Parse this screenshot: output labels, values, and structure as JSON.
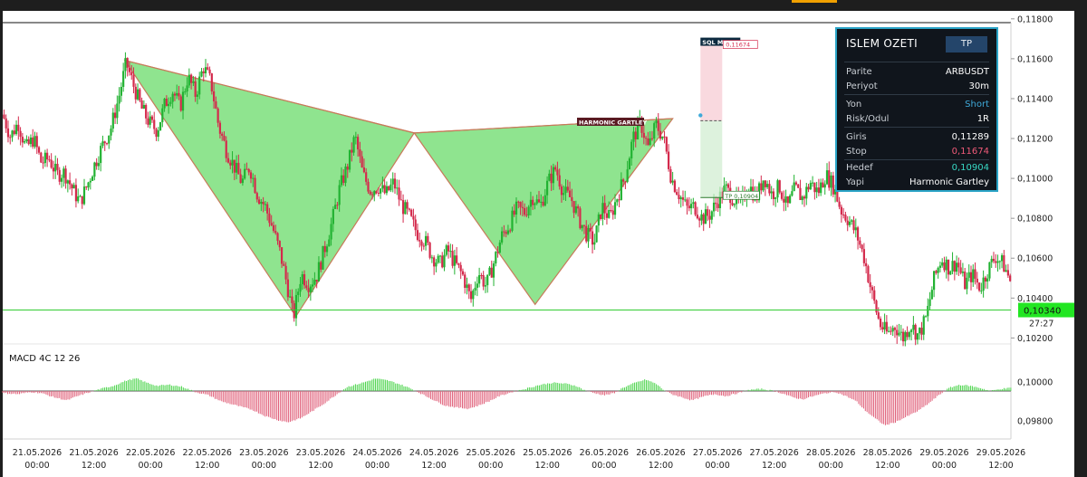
{
  "chart_data": {
    "type": "candlestick",
    "symbol": "ARBUSDT",
    "y_ticks": [
      "0,11800",
      "0,11600",
      "0,11400",
      "0,11200",
      "0,11000",
      "0,10800",
      "0,10600",
      "0,10400",
      "0,10200"
    ],
    "ylim": [
      0.1017,
      0.1184
    ],
    "x_ticks": [
      {
        "date": "21.05.2026",
        "time": "00:00"
      },
      {
        "date": "21.05.2026",
        "time": "12:00"
      },
      {
        "date": "22.05.2026",
        "time": "00:00"
      },
      {
        "date": "22.05.2026",
        "time": "12:00"
      },
      {
        "date": "23.05.2026",
        "time": "00:00"
      },
      {
        "date": "23.05.2026",
        "time": "12:00"
      },
      {
        "date": "24.05.2026",
        "time": "00:00"
      },
      {
        "date": "24.05.2026",
        "time": "12:00"
      },
      {
        "date": "25.05.2026",
        "time": "00:00"
      },
      {
        "date": "25.05.2026",
        "time": "12:00"
      },
      {
        "date": "26.05.2026",
        "time": "00:00"
      },
      {
        "date": "26.05.2026",
        "time": "12:00"
      },
      {
        "date": "27.05.2026",
        "time": "00:00"
      },
      {
        "date": "27.05.2026",
        "time": "12:00"
      },
      {
        "date": "28.05.2026",
        "time": "00:00"
      },
      {
        "date": "28.05.2026",
        "time": "12:00"
      },
      {
        "date": "29.05.2026",
        "time": "00:00"
      },
      {
        "date": "29.05.2026",
        "time": "12:00"
      }
    ],
    "price_path": [
      [
        0,
        0.1132
      ],
      [
        6,
        0.1121
      ],
      [
        12,
        0.1128
      ],
      [
        18,
        0.1115
      ],
      [
        24,
        0.112
      ],
      [
        30,
        0.1108
      ],
      [
        36,
        0.111
      ],
      [
        42,
        0.1102
      ],
      [
        48,
        0.1103
      ],
      [
        54,
        0.1095
      ],
      [
        60,
        0.1088
      ],
      [
        66,
        0.1097
      ],
      [
        72,
        0.1108
      ],
      [
        78,
        0.1117
      ],
      [
        84,
        0.1125
      ],
      [
        90,
        0.114
      ],
      [
        96,
        0.1158
      ],
      [
        102,
        0.1146
      ],
      [
        108,
        0.1135
      ],
      [
        114,
        0.1128
      ],
      [
        120,
        0.1124
      ],
      [
        126,
        0.1137
      ],
      [
        132,
        0.1144
      ],
      [
        138,
        0.1136
      ],
      [
        144,
        0.1151
      ],
      [
        150,
        0.1142
      ],
      [
        156,
        0.1156
      ],
      [
        162,
        0.1148
      ],
      [
        168,
        0.1126
      ],
      [
        174,
        0.1114
      ],
      [
        180,
        0.1106
      ],
      [
        186,
        0.1098
      ],
      [
        192,
        0.1106
      ],
      [
        198,
        0.1092
      ],
      [
        204,
        0.1086
      ],
      [
        210,
        0.1075
      ],
      [
        216,
        0.1062
      ],
      [
        222,
        0.1044
      ],
      [
        226,
        0.103
      ],
      [
        232,
        0.1052
      ],
      [
        238,
        0.1047
      ],
      [
        244,
        0.1051
      ],
      [
        250,
        0.1064
      ],
      [
        256,
        0.1078
      ],
      [
        262,
        0.1095
      ],
      [
        268,
        0.1106
      ],
      [
        274,
        0.1121
      ],
      [
        280,
        0.1102
      ],
      [
        286,
        0.1094
      ],
      [
        292,
        0.1096
      ],
      [
        298,
        0.1092
      ],
      [
        304,
        0.1098
      ],
      [
        310,
        0.1087
      ],
      [
        316,
        0.1081
      ],
      [
        322,
        0.1073
      ],
      [
        328,
        0.1069
      ],
      [
        334,
        0.1061
      ],
      [
        340,
        0.1057
      ],
      [
        346,
        0.1064
      ],
      [
        352,
        0.1057
      ],
      [
        358,
        0.1051
      ],
      [
        364,
        0.1039
      ],
      [
        370,
        0.1053
      ],
      [
        376,
        0.1046
      ],
      [
        382,
        0.1058
      ],
      [
        388,
        0.1071
      ],
      [
        394,
        0.1077
      ],
      [
        400,
        0.1085
      ],
      [
        406,
        0.1083
      ],
      [
        412,
        0.1091
      ],
      [
        418,
        0.1086
      ],
      [
        424,
        0.1098
      ],
      [
        430,
        0.1105
      ],
      [
        436,
        0.1093
      ],
      [
        442,
        0.109
      ],
      [
        448,
        0.108
      ],
      [
        454,
        0.1072
      ],
      [
        460,
        0.1068
      ],
      [
        466,
        0.1086
      ],
      [
        472,
        0.108
      ],
      [
        478,
        0.1091
      ],
      [
        484,
        0.1101
      ],
      [
        490,
        0.112
      ],
      [
        496,
        0.1128
      ],
      [
        502,
        0.1115
      ],
      [
        508,
        0.1127
      ],
      [
        514,
        0.112
      ],
      [
        520,
        0.11
      ],
      [
        526,
        0.1092
      ],
      [
        532,
        0.1085
      ],
      [
        538,
        0.1086
      ],
      [
        544,
        0.108
      ],
      [
        550,
        0.1082
      ],
      [
        556,
        0.1089
      ],
      [
        562,
        0.1095
      ],
      [
        568,
        0.109
      ],
      [
        574,
        0.1087
      ],
      [
        580,
        0.1097
      ],
      [
        586,
        0.109
      ],
      [
        592,
        0.1101
      ],
      [
        598,
        0.1092
      ],
      [
        604,
        0.1096
      ],
      [
        610,
        0.1085
      ],
      [
        616,
        0.1095
      ],
      [
        622,
        0.109
      ],
      [
        628,
        0.1098
      ],
      [
        634,
        0.1093
      ],
      [
        640,
        0.1102
      ],
      [
        646,
        0.1096
      ],
      [
        652,
        0.1084
      ],
      [
        658,
        0.1079
      ],
      [
        664,
        0.1072
      ],
      [
        670,
        0.106
      ],
      [
        676,
        0.1042
      ],
      [
        682,
        0.1027
      ],
      [
        688,
        0.1022
      ],
      [
        694,
        0.1026
      ],
      [
        700,
        0.102
      ],
      [
        706,
        0.1027
      ],
      [
        712,
        0.1021
      ],
      [
        718,
        0.103
      ],
      [
        724,
        0.1049
      ],
      [
        730,
        0.106
      ],
      [
        736,
        0.1055
      ],
      [
        742,
        0.1058
      ],
      [
        748,
        0.1047
      ],
      [
        754,
        0.1052
      ],
      [
        760,
        0.1045
      ],
      [
        766,
        0.1054
      ],
      [
        772,
        0.1061
      ],
      [
        778,
        0.1057
      ],
      [
        784,
        0.1048
      ]
    ],
    "harmonic_points": {
      "X": [
        95,
        0.11592
      ],
      "A": [
        228,
        0.10308
      ],
      "B": [
        320,
        0.11228
      ],
      "C": [
        414,
        0.10368
      ],
      "D": [
        521,
        0.113
      ]
    },
    "pattern_label": "HARMONIC GARTLEY",
    "sql_label": "SQL Memory",
    "stop_label": "0,11674",
    "stop_value": 0.11674,
    "entry_value": 0.11289,
    "tp_label": "TP 0,10904",
    "tp_value": 0.10904,
    "current_price": 0.1034,
    "current_price_label": "0,10340",
    "countdown": "27:27",
    "macd": {
      "title": "MACD 4C 12 26",
      "y_ticks": [
        "0,10000",
        "0,09800"
      ],
      "path": [
        [
          0,
          -2
        ],
        [
          12,
          -3
        ],
        [
          22,
          -1
        ],
        [
          30,
          -2
        ],
        [
          40,
          -6
        ],
        [
          50,
          -9
        ],
        [
          58,
          -5
        ],
        [
          68,
          -1
        ],
        [
          76,
          2
        ],
        [
          86,
          5
        ],
        [
          96,
          10
        ],
        [
          104,
          12
        ],
        [
          112,
          8
        ],
        [
          120,
          5
        ],
        [
          130,
          6
        ],
        [
          140,
          4
        ],
        [
          150,
          -1
        ],
        [
          160,
          -4
        ],
        [
          170,
          -10
        ],
        [
          182,
          -14
        ],
        [
          194,
          -18
        ],
        [
          204,
          -24
        ],
        [
          214,
          -28
        ],
        [
          222,
          -30
        ],
        [
          232,
          -26
        ],
        [
          240,
          -20
        ],
        [
          250,
          -12
        ],
        [
          260,
          -3
        ],
        [
          268,
          4
        ],
        [
          280,
          8
        ],
        [
          290,
          12
        ],
        [
          300,
          10
        ],
        [
          310,
          6
        ],
        [
          318,
          2
        ],
        [
          326,
          -3
        ],
        [
          334,
          -8
        ],
        [
          344,
          -14
        ],
        [
          354,
          -16
        ],
        [
          362,
          -17
        ],
        [
          370,
          -14
        ],
        [
          378,
          -10
        ],
        [
          386,
          -5
        ],
        [
          396,
          -1
        ],
        [
          406,
          2
        ],
        [
          418,
          6
        ],
        [
          428,
          8
        ],
        [
          438,
          7
        ],
        [
          446,
          5
        ],
        [
          452,
          1
        ],
        [
          460,
          -2
        ],
        [
          468,
          -4
        ],
        [
          476,
          -2
        ],
        [
          482,
          3
        ],
        [
          492,
          8
        ],
        [
          500,
          11
        ],
        [
          508,
          7
        ],
        [
          514,
          1
        ],
        [
          520,
          -3
        ],
        [
          528,
          -6
        ],
        [
          536,
          -9
        ],
        [
          546,
          -5
        ],
        [
          554,
          -3
        ],
        [
          562,
          -5
        ],
        [
          572,
          -2
        ],
        [
          580,
          1
        ],
        [
          590,
          2
        ],
        [
          600,
          0
        ],
        [
          608,
          -3
        ],
        [
          614,
          -6
        ],
        [
          622,
          -8
        ],
        [
          630,
          -5
        ],
        [
          640,
          -2
        ],
        [
          648,
          -1
        ],
        [
          656,
          -5
        ],
        [
          664,
          -10
        ],
        [
          670,
          -18
        ],
        [
          678,
          -26
        ],
        [
          686,
          -33
        ],
        [
          694,
          -30
        ],
        [
          704,
          -24
        ],
        [
          712,
          -19
        ],
        [
          720,
          -12
        ],
        [
          728,
          -4
        ],
        [
          736,
          3
        ],
        [
          744,
          6
        ],
        [
          752,
          5
        ],
        [
          760,
          3
        ],
        [
          768,
          0
        ],
        [
          776,
          2
        ],
        [
          784,
          3
        ]
      ]
    }
  },
  "summary": {
    "title": "ISLEM OZETI",
    "badge": "TP",
    "rows": [
      {
        "k": "Parite",
        "v": "ARBUSDT",
        "color": "#ffffff"
      },
      {
        "k": "Periyot",
        "v": "30m",
        "color": "#ffffff"
      },
      {
        "k": "Yon",
        "v": "Short",
        "color": "#3fa9d9"
      },
      {
        "k": "Risk/Odul",
        "v": "1R",
        "color": "#ffffff"
      },
      {
        "k": "Giris",
        "v": "0,11289",
        "color": "#ffffff"
      },
      {
        "k": "Stop",
        "v": "0,11674",
        "color": "#f05a78"
      },
      {
        "k": "Hedef",
        "v": "0,10904",
        "color": "#38d9c5"
      },
      {
        "k": "Yapi",
        "v": "Harmonic Gartley",
        "color": "#ffffff"
      }
    ]
  },
  "colors": {
    "bull": "#22b232",
    "bear": "#d42a4c",
    "pattern_fill": "#8fe48f",
    "pattern_stroke": "#c77a5a",
    "price_line": "#33cc33",
    "macd_pos": "#4cd44c",
    "macd_neg": "#e0607a"
  }
}
